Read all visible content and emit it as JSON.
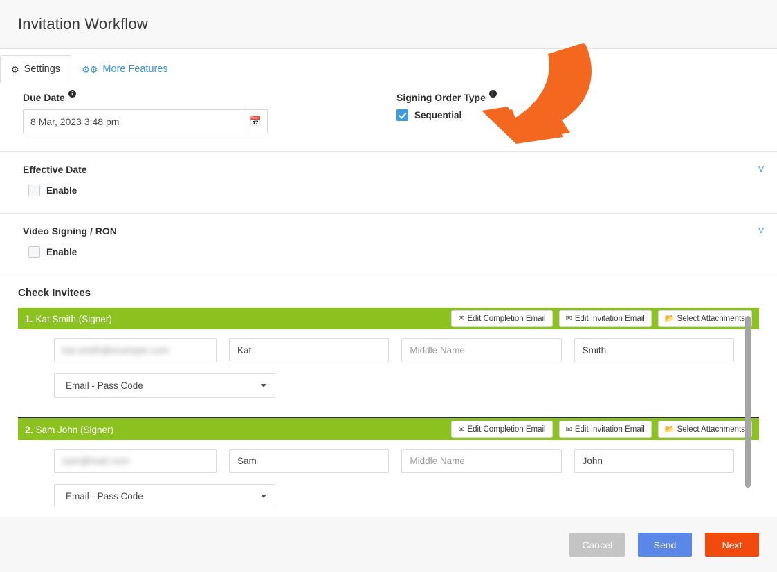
{
  "header": {
    "title": "Invitation Workflow"
  },
  "tabs": [
    {
      "label": "Settings",
      "icon": "gear-icon",
      "active": true
    },
    {
      "label": "More Features",
      "icon": "gears-icon",
      "active": false
    }
  ],
  "settings": {
    "due_date": {
      "label": "Due Date",
      "info": "i",
      "value": "8 Mar, 2023 3:48 pm",
      "calendar_icon": "calendar-icon"
    },
    "signing_order": {
      "label": "Signing Order Type",
      "info": "i",
      "checkbox_label": "Sequential",
      "checked": true
    }
  },
  "sections": [
    {
      "title": "Effective Date",
      "enable_label": "Enable",
      "checked": false,
      "chevron": "chevron-down-icon"
    },
    {
      "title": "Video Signing / RON",
      "enable_label": "Enable",
      "checked": false,
      "chevron": "chevron-down-icon"
    }
  ],
  "invitees": {
    "title": "Check Invitees",
    "buttons": {
      "completion": "Edit Completion Email",
      "invitation": "Edit Invitation Email",
      "attachments": "Select Attachments"
    },
    "signers": [
      {
        "index": "1.",
        "name": "Kat Smith (Signer)",
        "email": "redacted",
        "email_blur": "kat.smith@example.com",
        "first_name": "Kat",
        "middle_placeholder": "Middle Name",
        "last_name": "Smith",
        "auth_method": "Email - Pass Code"
      },
      {
        "index": "2.",
        "name": "Sam John (Signer)",
        "email": "redacted",
        "email_blur": "sam@mail.com",
        "first_name": "Sam",
        "middle_placeholder": "Middle Name",
        "last_name": "John",
        "auth_method": "Email - Pass Code"
      }
    ]
  },
  "footer": {
    "cancel": "Cancel",
    "send": "Send",
    "next": "Next"
  },
  "colors": {
    "green_header": "#8cc220",
    "accent_blue": "#3d9de0",
    "send_blue": "#5b87e8",
    "next_orange": "#f2490c",
    "cancel_gray": "#c4c4c4",
    "annotation_orange": "#f4671f"
  },
  "annotation": {
    "type": "curved-arrow",
    "color": "#f4671f",
    "points_to": "Sequential checkbox"
  }
}
